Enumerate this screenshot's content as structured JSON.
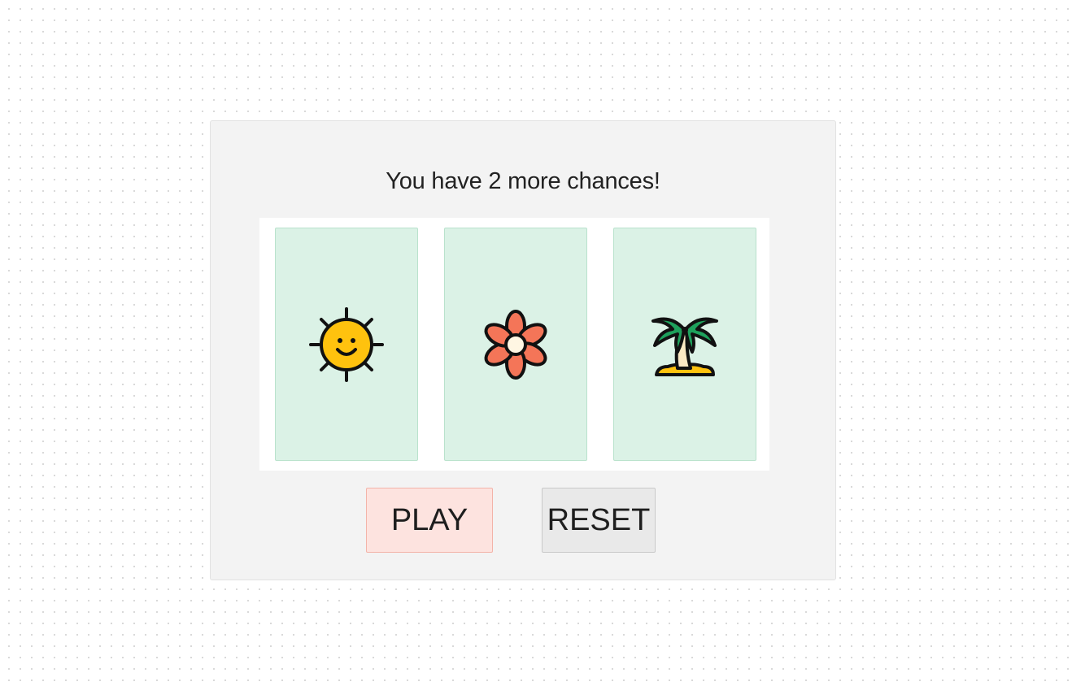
{
  "game": {
    "status_text": "You have 2 more chances!",
    "reels": [
      {
        "symbol": "sun-icon"
      },
      {
        "symbol": "flower-icon"
      },
      {
        "symbol": "palm-tree-icon"
      }
    ],
    "buttons": {
      "play_label": "PLAY",
      "reset_label": "RESET"
    }
  },
  "colors": {
    "panel_bg": "#f3f3f3",
    "reel_bg": "#dbf2e6",
    "play_bg": "#fde3df",
    "reset_bg": "#e9e9e9",
    "sun": "#ffc20e",
    "flower": "#f47558",
    "palm_leaves": "#1ea15c"
  }
}
